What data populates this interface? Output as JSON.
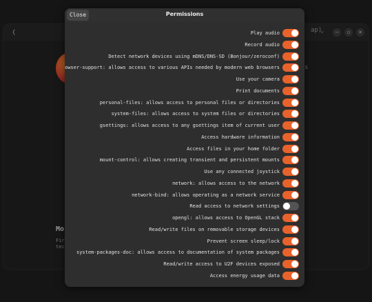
{
  "dialog": {
    "title": "Permissions",
    "close_label": "Close"
  },
  "background": {
    "back_icon": "chevron-left-icon",
    "app_name": "Mo",
    "description_line1": "Fir",
    "description_line2": "tec",
    "header_hint": "ap)",
    "header_hint2": "⌄",
    "side_hint": "s"
  },
  "colors": {
    "accent": "#e8622c",
    "toggle_off": "#545454",
    "dialog_bg": "#2e2e2e"
  },
  "permissions": [
    {
      "label": "Play audio",
      "enabled": true
    },
    {
      "label": "Record audio",
      "enabled": true
    },
    {
      "label": "Detect network devices using mDNS/DNS-SD (Bonjour/zeroconf)",
      "enabled": true
    },
    {
      "label": "browser-support: allows access to various APIs needed by modern web browsers",
      "enabled": true
    },
    {
      "label": "Use your camera",
      "enabled": true
    },
    {
      "label": "Print documents",
      "enabled": true
    },
    {
      "label": "personal-files: allows access to personal files or directories",
      "enabled": true
    },
    {
      "label": "system-files: allows access to system files or directories",
      "enabled": true
    },
    {
      "label": "gsettings: allows access to any gsettings item of current user",
      "enabled": true
    },
    {
      "label": "Access hardware information",
      "enabled": true
    },
    {
      "label": "Access files in your home folder",
      "enabled": true
    },
    {
      "label": "mount-control: allows creating transient and persistent mounts",
      "enabled": true
    },
    {
      "label": "Use any connected joystick",
      "enabled": true
    },
    {
      "label": "network: allows access to the network",
      "enabled": true
    },
    {
      "label": "network-bind: allows operating as a network service",
      "enabled": true
    },
    {
      "label": "Read access to network settings",
      "enabled": false
    },
    {
      "label": "opengl: allows access to OpenGL stack",
      "enabled": true
    },
    {
      "label": "Read/write files on removable storage devices",
      "enabled": true
    },
    {
      "label": "Prevent screen sleep/lock",
      "enabled": true
    },
    {
      "label": "system-packages-doc: allows access to documentation of system packages",
      "enabled": true
    },
    {
      "label": "Read/write access to U2F devices exposed",
      "enabled": true
    },
    {
      "label": "Access energy usage data",
      "enabled": true
    }
  ]
}
